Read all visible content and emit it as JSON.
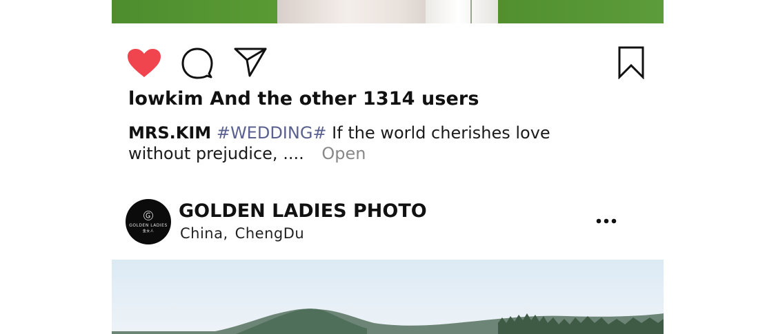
{
  "previous_post": {
    "likes_text": "lowkim And the other 1314 users",
    "caption": {
      "author": "MRS.KIM",
      "hashtag": "#WEDDING#",
      "text": "If the world cherishes love without prejudice, ....",
      "open_label": "Open"
    },
    "actions": {
      "like_icon": "heart-icon",
      "comment_icon": "comment-icon",
      "share_icon": "paper-plane-icon",
      "save_icon": "bookmark-icon",
      "liked": true,
      "like_color": "#f0454f"
    }
  },
  "next_post": {
    "account_name": "GOLDEN LADIES PHOTO",
    "location_country": "China,",
    "location_city": "ChengDu",
    "avatar_line1": "GOLDEN LADIES",
    "avatar_line2": "金女人",
    "more_icon": "more-horizontal-icon"
  }
}
